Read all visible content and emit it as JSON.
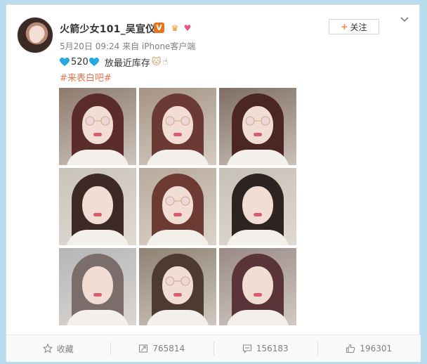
{
  "user": {
    "name": "火箭少女101_吴宣仪",
    "verified_mark": "V",
    "badges": [
      "crown-badge-icon",
      "heart-badge-icon"
    ]
  },
  "post": {
    "meta": "5月20日 09:24 来自 iPhone客户端",
    "number": "520",
    "body": "放最近库存",
    "hashtag": "#来表白吧#"
  },
  "follow_label": "关注",
  "photos": [
    {
      "bg": "#8d7a6d",
      "hair": "#5a2d2a"
    },
    {
      "bg": "#a59384",
      "hair": "#6b3a35"
    },
    {
      "bg": "#7f6d63",
      "hair": "#4b2622"
    },
    {
      "bg": "#c9c3ba",
      "hair": "#3d2a24"
    },
    {
      "bg": "#b8aa9c",
      "hair": "#6e3a34"
    },
    {
      "bg": "#c6c0b6",
      "hair": "#2d2320"
    },
    {
      "bg": "#b6b6b8",
      "hair": "#7a6d6a"
    },
    {
      "bg": "#8f8274",
      "hair": "#4d3b33"
    },
    {
      "bg": "#9a8a85",
      "hair": "#5a3438"
    }
  ],
  "actions": {
    "favorite": "收藏",
    "forward": "765814",
    "comment": "156183",
    "like": "196301"
  },
  "colors": {
    "accent": "#eb7350",
    "verified": "#e6741c",
    "heart": "#26a9e0"
  }
}
